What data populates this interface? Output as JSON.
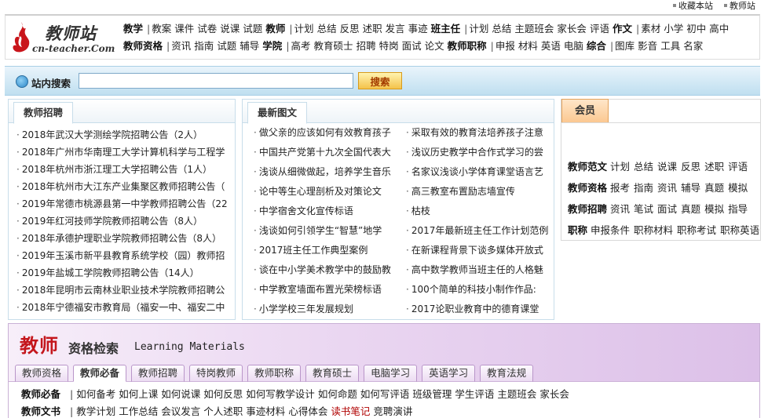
{
  "toplinks": [
    "收藏本站",
    "教师站"
  ],
  "logo": {
    "title": "教师站",
    "domain": "cn-teacher.Com"
  },
  "nav": {
    "row1": [
      {
        "cat": "教学",
        "items": [
          "教案",
          "课件",
          "试卷",
          "说课",
          "试题"
        ]
      },
      {
        "cat": "教师",
        "items": [
          "计划",
          "总结",
          "反思",
          "述职",
          "发言",
          "事迹"
        ]
      },
      {
        "cat": "班主任",
        "items": [
          "计划",
          "总结",
          "主题班会",
          "家长会",
          "评语"
        ]
      },
      {
        "cat": "作文",
        "items": [
          "素材",
          "小学",
          "初中",
          "高中"
        ]
      }
    ],
    "row2": [
      {
        "cat": "教师资格",
        "items": [
          "资讯",
          "指南",
          "试题",
          "辅导"
        ]
      },
      {
        "cat": "学院",
        "items": [
          "高考",
          "教育硕士",
          "招聘",
          "特岗",
          "面试",
          "论文"
        ]
      },
      {
        "cat": "教师职称",
        "items": [
          "申报",
          "材料",
          "英语",
          "电脑"
        ]
      },
      {
        "cat": "综合",
        "items": [
          "图库",
          "影音",
          "工具",
          "名家"
        ]
      }
    ]
  },
  "search": {
    "label": "站内搜索",
    "placeholder": "",
    "value": "",
    "button": "搜索"
  },
  "recruit": {
    "tab": "教师招聘",
    "items": [
      "2018年武汉大学测绘学院招聘公告（2人）",
      "2018年广州市华南理工大学计算机科学与工程学",
      "2018年杭州市浙江理工大学招聘公告（1人）",
      "2018年杭州市大江东产业集聚区教师招聘公告（",
      "2019年常德市桃源县第一中学教师招聘公告（22",
      "2019年红河技师学院教师招聘公告（8人）",
      "2018年承德护理职业学院教师招聘公告（8人）",
      "2019年玉溪市新平县教育系统学校（园）教师招",
      "2019年盐城工学院教师招聘公告（14人）",
      "2018年昆明市云南林业职业技术学院教师招聘公",
      "2018年宁德福安市教育局（福安一中、福安二中"
    ]
  },
  "latest": {
    "tab": "最新图文",
    "items": [
      "做父亲的应该如何有效教育孩子",
      "采取有效的教育法培养孩子注意",
      "中国共产党第十九次全国代表大",
      "浅议历史教学中合作式学习的尝",
      "浅谈从细微做起，培养学生音乐",
      "名家议浅谈小学体育课堂语言艺",
      "论中等生心理剖析及对策论文",
      "高三教室布置励志墙宣传",
      "中学宿舍文化宣传标语",
      "枯枝",
      "浅谈如何引领学生“智慧”地学",
      "2017年最新班主任工作计划范例",
      "2017班主任工作典型案例",
      "在新课程背景下谈多媒体开放式",
      "谈在中小学美术教学中的鼓励教",
      "高中数学教师当班主任的人格魅",
      "中学教室墙面布置光荣榜标语",
      "100个简单的科技小制作作品:",
      "小学学校三年发展规划",
      "2017论职业教育中的德育课堂"
    ]
  },
  "member": {
    "tab": "会员",
    "rows": [
      {
        "cat": "教师范文",
        "items": [
          "计划",
          "总结",
          "说课",
          "反思",
          "述职",
          "评语"
        ]
      },
      {
        "cat": "教师资格",
        "items": [
          "报考",
          "指南",
          "资讯",
          "辅导",
          "真题",
          "模拟"
        ]
      },
      {
        "cat": "教师招聘",
        "items": [
          "资讯",
          "笔试",
          "面试",
          "真题",
          "模拟",
          "指导"
        ]
      },
      {
        "cat": "职称",
        "items": [
          "申报条件",
          "职称材料",
          "职称考试",
          "职称英语"
        ]
      }
    ]
  },
  "qual": {
    "title_red": "教师",
    "title_black": "资格检索",
    "title_en": "Learning Materials",
    "tabs": [
      "教师资格",
      "教师必备",
      "教师招聘",
      "特岗教师",
      "教师职称",
      "教育硕士",
      "电脑学习",
      "英语学习",
      "教育法规"
    ],
    "active_tab": 1,
    "rows": [
      {
        "cat": "教师必备",
        "items": [
          "如何备考",
          "如何上课",
          "如何说课",
          "如何反思",
          "如何写教学设计",
          "如何命题",
          "如何写评语",
          "班级管理",
          "学生评语",
          "主题班会",
          "家长会"
        ]
      },
      {
        "cat": "教师文书",
        "items": [
          "教学计划",
          "工作总结",
          "会议发言",
          "个人述职",
          "事迹材料",
          "心得体会",
          "读书笔记",
          "竞聘演讲"
        ]
      }
    ],
    "highlight_color": "#b00000"
  },
  "colors": {
    "accent_red": "#c4161c",
    "search_blue": "#bfdff0",
    "button_orange": "#f4c24a"
  }
}
